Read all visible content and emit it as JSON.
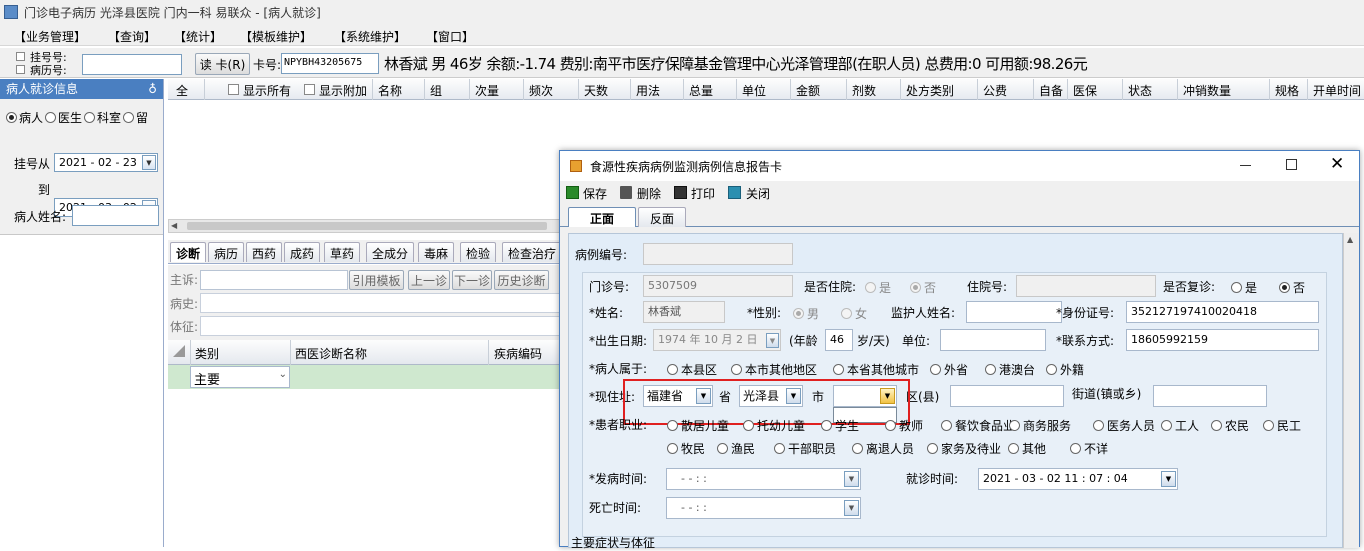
{
  "window": {
    "title": "门诊电子病历  光泽县医院  门内一科  易联众 - [病人就诊]"
  },
  "menu": [
    "【业务管理】",
    "【查询】",
    "【统计】",
    "【模板维护】",
    "【系统维护】",
    "【窗口】"
  ],
  "patient_bar": {
    "reg_label": "挂号号:",
    "record_label": "病历号:",
    "read_card": "读 卡(R)",
    "card_label": "卡号:",
    "card_no": "NPYBH43205675",
    "info": "林香斌 男 46岁 余额:-1.74 费别:南平市医疗保障基金管理中心光泽管理部(在职人员) 总费用:0 可用额:98.26元"
  },
  "left_panel": {
    "header": "病人就诊信息",
    "pin": "♁",
    "radios": [
      {
        "label": "病人",
        "on": true
      },
      {
        "label": "医生",
        "on": false
      },
      {
        "label": "科室",
        "on": false
      },
      {
        "label": "留",
        "on": false
      }
    ],
    "reg_from_label": "挂号从",
    "reg_from": "2021 - 02 - 23",
    "to_label": "到",
    "reg_to": "2021 - 03 - 02",
    "name_label": "病人姓名:"
  },
  "grid_headers": {
    "all": "全",
    "show_all": "显示所有",
    "show_extra": "显示附加",
    "cols": [
      "名称",
      "组",
      "次量",
      "频次",
      "天数",
      "用法",
      "总量",
      "单位",
      "金额",
      "剂数",
      "处方类别",
      "公费",
      "自备",
      "医保",
      "状态",
      "冲销数量",
      "规格",
      "开单时间"
    ]
  },
  "lower_tabs": [
    "诊断",
    "病历",
    "西药",
    "成药",
    "草药",
    "全成分",
    "毒麻",
    "检验",
    "检查治疗"
  ],
  "diag_form": {
    "complaint": "主诉:",
    "history": "病史:",
    "exam": "体征:",
    "btn_template": "引用模板",
    "btn_prev": "上一诊",
    "btn_next": "下一诊",
    "btn_hist": "历史诊断"
  },
  "diag_table": {
    "headers": [
      "类别",
      "西医诊断名称",
      "疾病编码"
    ],
    "row_type": "主要"
  },
  "dialog": {
    "title": "食源性疾病病例监测病例信息报告卡",
    "toolbar": [
      "保存",
      "删除",
      "打印",
      "关闭"
    ],
    "tabs": [
      "正面",
      "反面"
    ],
    "case_no_label": "病例编号:",
    "clinic_no_label": "门诊号:",
    "clinic_no": "5307509",
    "inpatient_q": "是否住院:",
    "yes": "是",
    "no": "否",
    "inpatient_no_label": "住院号:",
    "revisit_q": "是否复诊:",
    "name_label": "*姓名:",
    "name": "林香斌",
    "sex_label": "*性别:",
    "male": "男",
    "female": "女",
    "guardian_label": "监护人姓名:",
    "id_label": "*身份证号:",
    "id_no": "352127197410020418",
    "birth_label": "*出生日期:",
    "birth": "1974 年 10 月 2 日",
    "age_open": "(年龄",
    "age": "46",
    "age_close": "岁/天)",
    "unit_label": "单位:",
    "contact_label": "*联系方式:",
    "contact": "18605992159",
    "belong_label": "*病人属于:",
    "belong_opts": [
      "本县区",
      "本市其他地区",
      "本省其他城市",
      "外省",
      "港澳台",
      "外籍"
    ],
    "address_label": "*现住址:",
    "province": "福建省",
    "prov_suffix": "省",
    "county": "光泽县",
    "city_suffix": "市",
    "district_suffix": "区(县)",
    "street_label": "街道(镇或乡)",
    "job_label": "*患者职业:",
    "jobs_row1": [
      "散居儿童",
      "托幼儿童",
      "学生",
      "教师",
      "餐饮食品业",
      "商务服务",
      "医务人员",
      "工人",
      "农民",
      "民工"
    ],
    "jobs_row2": [
      "牧民",
      "渔民",
      "干部职员",
      "离退人员",
      "家务及待业",
      "其他",
      "不详"
    ],
    "onset_label": "*发病时间:",
    "onset": "-   -       :   :",
    "visit_label": "就诊时间:",
    "visit": "2021 - 03 - 02    11 : 07 : 04",
    "death_label": "死亡时间:",
    "death": "-   -       :   :",
    "symptoms_label": "主要症状与体征"
  },
  "colors": {
    "accent": "#4a7fc1",
    "highlight": "#e02020",
    "row_green": "#cfe8cf"
  }
}
